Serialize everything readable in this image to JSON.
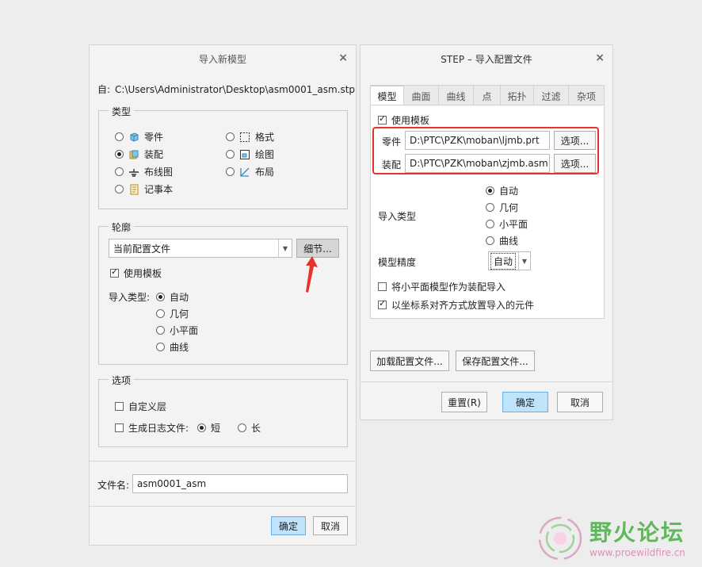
{
  "left_dialog": {
    "title": "导入新模型",
    "close": "×",
    "source_label": "自:",
    "source_path": "C:\\Users\\Administrator\\Desktop\\asm0001_asm.stp",
    "type_group": {
      "title": "类型",
      "items": [
        {
          "label": "零件",
          "icon": "part-icon",
          "selected": false
        },
        {
          "label": "装配",
          "icon": "assembly-icon",
          "selected": true
        },
        {
          "label": "布线图",
          "icon": "harness-icon",
          "selected": false
        },
        {
          "label": "记事本",
          "icon": "notebook-icon",
          "selected": false
        },
        {
          "label": "格式",
          "icon": "format-icon",
          "selected": false
        },
        {
          "label": "绘图",
          "icon": "drawing-icon",
          "selected": false
        },
        {
          "label": "布局",
          "icon": "layout-icon",
          "selected": false
        }
      ]
    },
    "profile_group": {
      "title": "轮廓",
      "dropdown_value": "当前配置文件",
      "details_button": "细节...",
      "use_template": "使用模板",
      "import_type_label": "导入类型:",
      "import_options": [
        "自动",
        "几何",
        "小平面",
        "曲线"
      ],
      "selected_option": "自动"
    },
    "options_group": {
      "title": "选项",
      "custom_layer": "自定义层",
      "log_file": "生成日志文件:",
      "short": "短",
      "long": "长"
    },
    "filename_label": "文件名:",
    "filename_value": "asm0001_asm",
    "ok": "确定",
    "cancel": "取消"
  },
  "right_dialog": {
    "title": "STEP – 导入配置文件",
    "close": "×",
    "tabs": [
      "模型",
      "曲面",
      "曲线",
      "点",
      "拓扑",
      "过滤",
      "杂项"
    ],
    "active_tab": "模型",
    "use_template": "使用模板",
    "part_label": "零件",
    "part_path": "D:\\PTC\\PZK\\moban\\ljmb.prt",
    "asm_label": "装配",
    "asm_path": "D:\\PTC\\PZK\\moban\\zjmb.asm",
    "options_button": "选项...",
    "import_type_label": "导入类型",
    "import_options": [
      "自动",
      "几何",
      "小平面",
      "曲线"
    ],
    "model_precision_label": "模型精度",
    "precision_value": "自动",
    "facet_as_assembly": "将小平面模型作为装配导入",
    "align_csys": "以坐标系对齐方式放置导入的元件",
    "load_profile": "加载配置文件...",
    "save_profile": "保存配置文件...",
    "reset": "重置(R)",
    "ok": "确定",
    "cancel": "取消"
  },
  "watermark": {
    "text_cn": "野火论坛",
    "url": "www.proewildfire.cn"
  },
  "colors": {
    "highlight_red": "#e8312a",
    "primary_button": "#bfe3fb",
    "watermark_green": "#5fb85a"
  }
}
